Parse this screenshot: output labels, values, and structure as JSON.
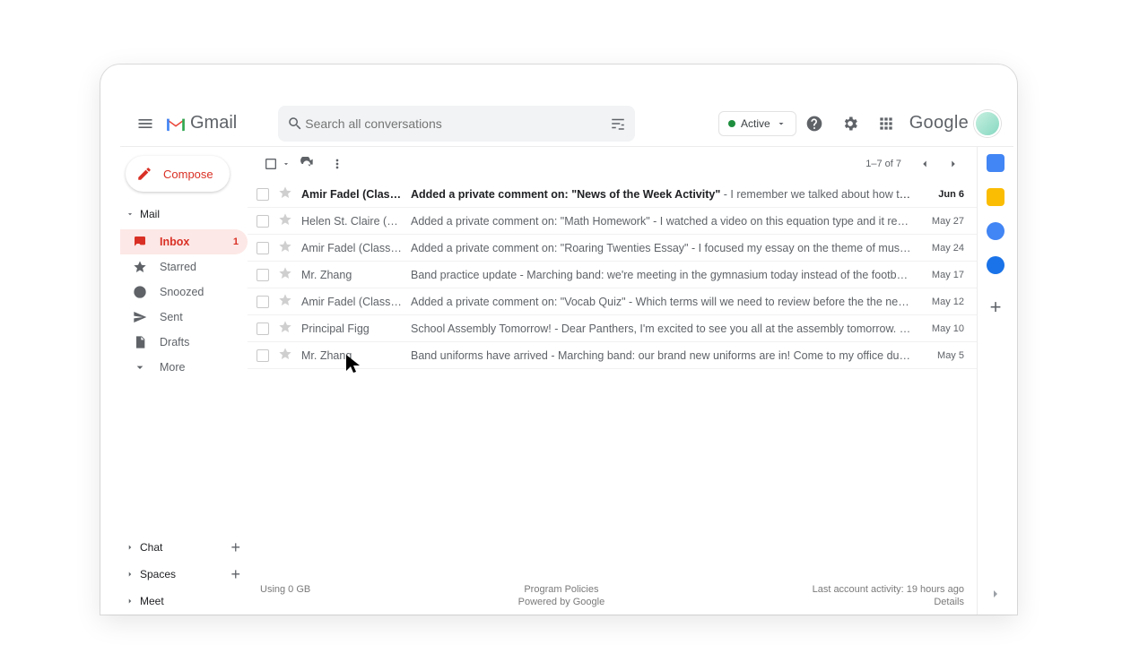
{
  "header": {
    "product": "Gmail",
    "search_placeholder": "Search all conversations",
    "status_label": "Active",
    "google_word": "Google"
  },
  "compose_label": "Compose",
  "sections": {
    "mail": "Mail",
    "chat": "Chat",
    "spaces": "Spaces",
    "meet": "Meet"
  },
  "nav": {
    "inbox": "Inbox",
    "inbox_badge": "1",
    "starred": "Starred",
    "snoozed": "Snoozed",
    "sent": "Sent",
    "drafts": "Drafts",
    "more": "More"
  },
  "toolbar": {
    "range": "1–7 of 7"
  },
  "emails": [
    {
      "sender": "Amir Fadel (Classroom)",
      "subject": "Added a private comment on: \"News of the Week Activity\"",
      "snippet": " - I remember we talked about how to do this in class, but I forgot the method. Can you please help me?",
      "date": "Jun 6",
      "unread": true
    },
    {
      "sender": "Helen St. Claire (Classroom)",
      "subject": "Added a private comment on: \"Math Homework\"",
      "snippet": " - I watched a video on this equation type and it really helped, thank you!",
      "date": "May 27",
      "unread": false
    },
    {
      "sender": "Amir Fadel (Classroom)",
      "subject": "Added a private comment on: \"Roaring Twenties Essay\"",
      "snippet": " - I focused my essay on the theme of music and dance throughout this decade, per your feedback.",
      "date": "May 24",
      "unread": false
    },
    {
      "sender": "Mr. Zhang",
      "subject": "Band practice update",
      "snippet": " - Marching band: we're meeting in the gymnasium today instead of the football field.",
      "date": "May 17",
      "unread": false
    },
    {
      "sender": "Amir Fadel (Classroom)",
      "subject": "Added a private comment on: \"Vocab Quiz\"",
      "snippet": " - Which terms will we need to review before the the next quiz?",
      "date": "May 12",
      "unread": false
    },
    {
      "sender": "Principal Figg",
      "subject": "School Assembly Tomorrow!",
      "snippet": " - Dear Panthers, I'm excited to see you all at the assembly tomorrow. Be sure to arrive on time!",
      "date": "May 10",
      "unread": false
    },
    {
      "sender": "Mr. Zhang",
      "subject": "Band uniforms have arrived",
      "snippet": " - Marching band: our brand new uniforms are in! Come to my office during your free period today to pick yours up.",
      "date": "May 5",
      "unread": false
    }
  ],
  "footer": {
    "storage": "Using 0 GB",
    "policies": "Program Policies",
    "powered": "Powered by Google",
    "activity": "Last account activity: 19 hours ago",
    "details": "Details"
  }
}
